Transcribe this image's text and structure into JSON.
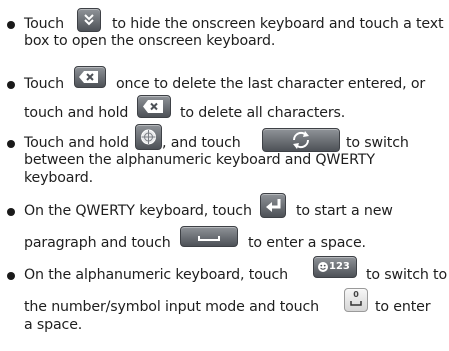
{
  "bullets": [
    {
      "line1_a": "Touch",
      "line1_b": "to hide the onscreen keyboard and touch a text",
      "line2": "box to open the onscreen keyboard.",
      "icon": "hide-keyboard-icon"
    },
    {
      "line1_a": "Touch",
      "line1_b": "once to delete the last character entered, or",
      "line2_a": "touch and hold",
      "line2_b": "to delete all characters.",
      "icon": "delete-key-icon"
    },
    {
      "line1_a": "Touch and hold",
      "line1_b": ", and touch",
      "line1_c": "to switch",
      "line2": "between the alphanumeric keyboard and QWERTY",
      "line3": "keyboard.",
      "icons": [
        "input-method-icon",
        "switch-keyboard-icon"
      ]
    },
    {
      "line1_a": "On the QWERTY keyboard, touch",
      "line1_b": "to start a new",
      "line2_a": "paragraph and touch",
      "line2_b": "to enter a space.",
      "icons": [
        "enter-key-icon",
        "space-key-icon"
      ]
    },
    {
      "line1_a": "On the alphanumeric keyboard, touch",
      "line1_b": "to switch to",
      "key_label": "123",
      "line2_a": "the number/symbol input mode and touch",
      "line2_b": "to enter",
      "zero_label": "0",
      "line3": "a space.",
      "icons": [
        "symbol-mode-key-icon",
        "zero-space-key-icon"
      ]
    }
  ]
}
